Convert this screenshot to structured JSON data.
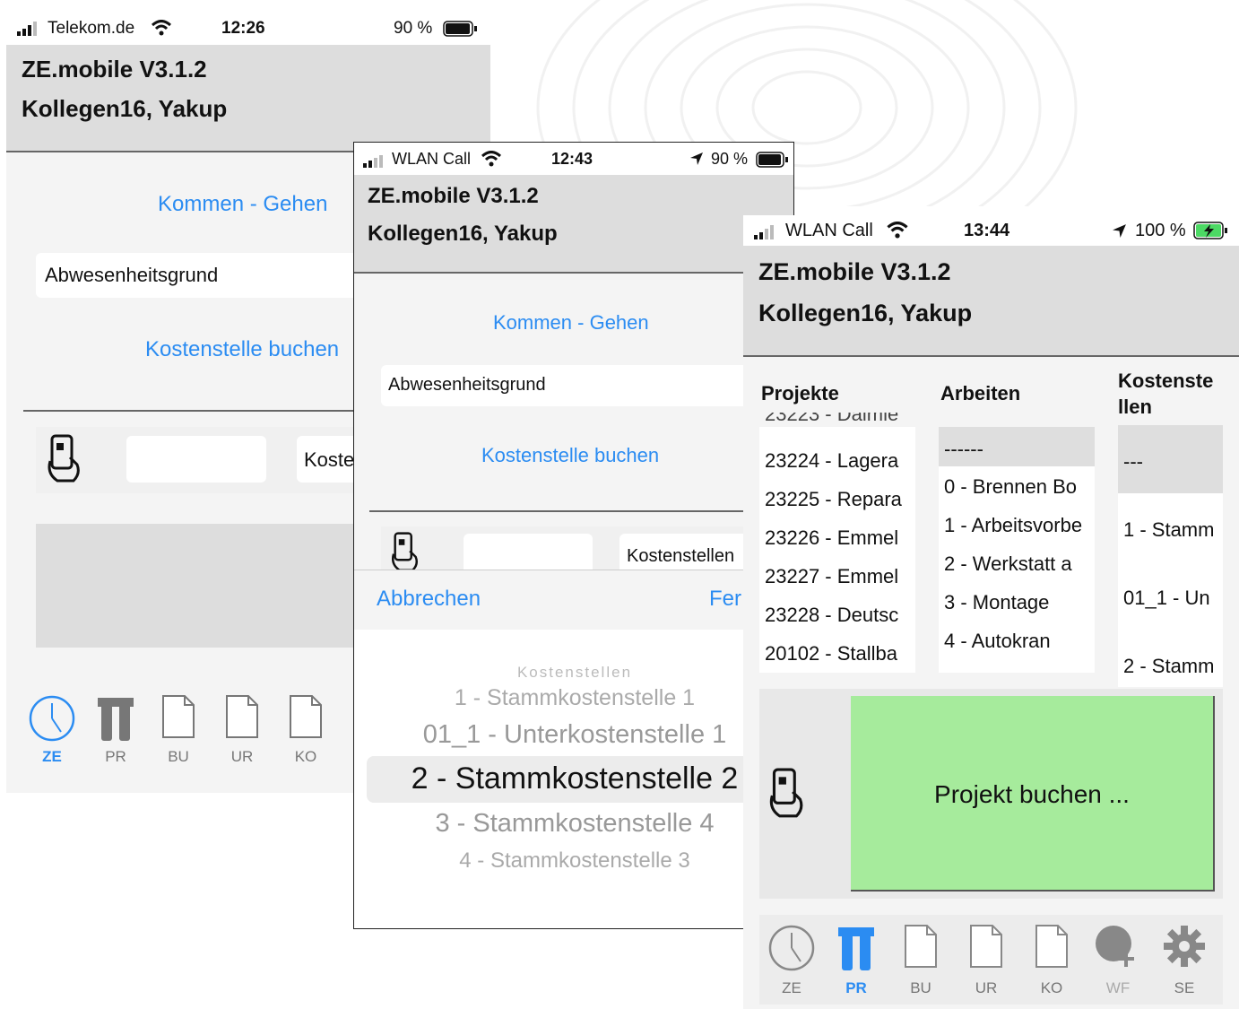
{
  "phone1": {
    "status": {
      "carrier": "Telekom.de",
      "time": "12:26",
      "battery": "90 %"
    },
    "header": {
      "app_title": "ZE.mobile V3.1.2",
      "user": "Kollegen16, Yakup"
    },
    "kommen_gehen": "Kommen - Gehen",
    "abwesenheit": "Abwesenheitsgrund",
    "kostenstelle_buchen": "Kostenstelle buchen",
    "kosten_field": "Koste",
    "tabs": [
      {
        "label": "ZE",
        "icon": "clock-icon",
        "active": true
      },
      {
        "label": "PR",
        "icon": "tools-icon",
        "active": false
      },
      {
        "label": "BU",
        "icon": "document-icon",
        "active": false
      },
      {
        "label": "UR",
        "icon": "document-icon",
        "active": false
      },
      {
        "label": "KO",
        "icon": "document-icon",
        "active": false
      }
    ]
  },
  "phone2": {
    "status": {
      "carrier": "WLAN Call",
      "time": "12:43",
      "battery": "90 %"
    },
    "header": {
      "app_title": "ZE.mobile V3.1.2",
      "user": "Kollegen16, Yakup"
    },
    "kommen_gehen": "Kommen - Gehen",
    "abwesenheit": "Abwesenheitsgrund",
    "kostenstelle_buchen": "Kostenstelle buchen",
    "kostenstellen_field": "Kostenstellen",
    "picker": {
      "cancel": "Abbrechen",
      "done": "Fer",
      "title": "Kostenstellen",
      "items": [
        "1 - Stammkostenstelle 1",
        "01_1 - Unterkostenstelle 1",
        "2 - Stammkostenstelle 2",
        "3 - Stammkostenstelle 4",
        "4 - Stammkostenstelle 3"
      ],
      "selected_index": 2
    }
  },
  "phone3": {
    "status": {
      "carrier": "WLAN Call",
      "time": "13:44",
      "battery": "100 %"
    },
    "header": {
      "app_title": "ZE.mobile V3.1.2",
      "user": "Kollegen16, Yakup"
    },
    "columns": {
      "projekte": {
        "title": "Projekte",
        "partial_top": "23223 - Daimle",
        "items": [
          "23224 - Lagera",
          "23225 - Repara",
          "23226 - Emmel",
          "23227 - Emmel",
          "23228 - Deutsc",
          "20102 - Stallba"
        ]
      },
      "arbeiten": {
        "title": "Arbeiten",
        "items": [
          "------",
          "0 - Brennen Bo",
          "1 - Arbeitsvorbe",
          "2 - Werkstatt  a",
          "3 - Montage",
          "4 - Autokran"
        ]
      },
      "kostenstellen": {
        "title": "Kostenste llen",
        "items": [
          "---",
          "1 - Stamm",
          "01_1 - Un",
          "2 - Stamm"
        ]
      }
    },
    "projekt_buchen": "Projekt buchen ...",
    "accent_green": "#a6eb9c",
    "tabs": [
      {
        "label": "ZE",
        "icon": "clock-icon",
        "active": false
      },
      {
        "label": "PR",
        "icon": "tools-icon",
        "active": true
      },
      {
        "label": "BU",
        "icon": "document-icon",
        "active": false
      },
      {
        "label": "UR",
        "icon": "document-icon",
        "active": false
      },
      {
        "label": "KO",
        "icon": "document-icon",
        "active": false
      },
      {
        "label": "WF",
        "icon": "globe-plus-icon",
        "active": false
      },
      {
        "label": "SE",
        "icon": "gear-icon",
        "active": false
      }
    ]
  },
  "colors": {
    "link_blue": "#2b8cf2",
    "header_gray": "#dddddd"
  }
}
